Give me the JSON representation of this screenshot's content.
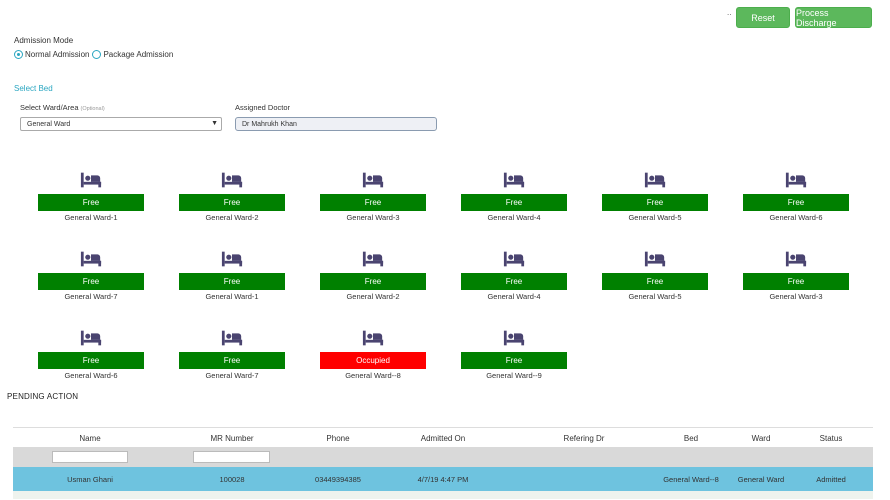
{
  "header": {
    "dots": "..",
    "reset_label": "Reset",
    "discharge_label": "Process Discharge"
  },
  "admission": {
    "label": "Admission Mode",
    "options": [
      "Normal Admission",
      "Package Admission"
    ],
    "selected": "Normal Admission"
  },
  "select_bed_label": "Select Bed",
  "ward": {
    "label": "Select Ward/Area",
    "optional": "(Optional)",
    "value": "General Ward"
  },
  "doctor": {
    "label": "Assigned Doctor",
    "value": "Dr Mahrukh Khan"
  },
  "beds": [
    {
      "name": "General Ward-1",
      "status": "Free"
    },
    {
      "name": "General Ward-2",
      "status": "Free"
    },
    {
      "name": "General Ward-3",
      "status": "Free"
    },
    {
      "name": "General Ward-4",
      "status": "Free"
    },
    {
      "name": "General Ward-5",
      "status": "Free"
    },
    {
      "name": "General Ward-6",
      "status": "Free"
    },
    {
      "name": "General Ward-7",
      "status": "Free"
    },
    {
      "name": "General Ward-1",
      "status": "Free"
    },
    {
      "name": "General Ward-2",
      "status": "Free"
    },
    {
      "name": "General Ward-4",
      "status": "Free"
    },
    {
      "name": "General Ward-5",
      "status": "Free"
    },
    {
      "name": "General Ward-3",
      "status": "Free"
    },
    {
      "name": "General Ward-6",
      "status": "Free"
    },
    {
      "name": "General Ward-7",
      "status": "Free"
    },
    {
      "name": "General Ward--8",
      "status": "Occupied"
    },
    {
      "name": "General Ward--9",
      "status": "Free"
    }
  ],
  "colors": {
    "free": "#008000",
    "occupied": "#ff0000",
    "button": "#5cb85c",
    "row_highlight": "#6ec3df",
    "accent": "#2aa6c1"
  },
  "pending_label": "PENDING ACTION",
  "table": {
    "columns": [
      "Name",
      "MR Number",
      "Phone",
      "Admitted On",
      "Refering Dr",
      "Bed",
      "Ward",
      "Status"
    ],
    "rows": [
      {
        "Name": "Usman Ghani",
        "MR Number": "100028",
        "Phone": "03449394385",
        "Admitted On": "4/7/19 4:47 PM",
        "Refering Dr": "",
        "Bed": "General Ward--8",
        "Ward": "General Ward",
        "Status": "Admitted"
      }
    ]
  }
}
